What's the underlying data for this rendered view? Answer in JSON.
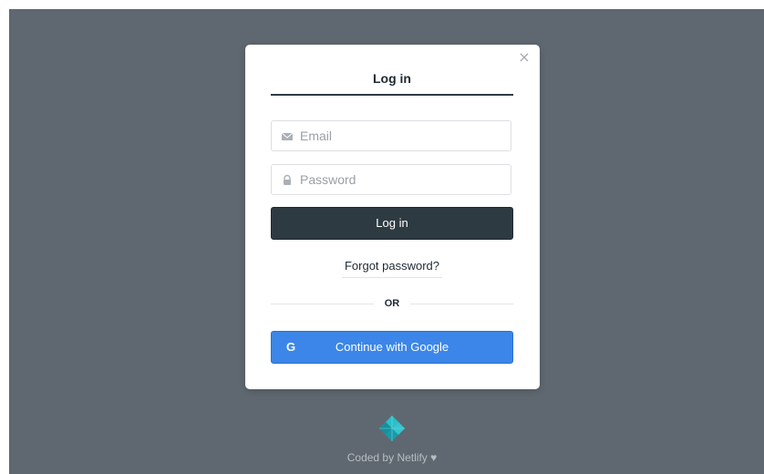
{
  "modal": {
    "close_glyph": "×",
    "tab_label": "Log in",
    "email": {
      "placeholder": "Email",
      "value": "",
      "icon": "envelope-icon"
    },
    "password": {
      "placeholder": "Password",
      "value": "",
      "icon": "lock-icon"
    },
    "login_button_label": "Log in",
    "forgot_password_label": "Forgot password?",
    "divider_label": "OR",
    "google_button": {
      "icon_glyph": "G",
      "label": "Continue with Google"
    }
  },
  "footer": {
    "logo_icon": "netlify-logo-icon",
    "text": "Coded by Netlify ♥"
  },
  "colors": {
    "backdrop": "#5f6870",
    "login_button": "#2e3a42",
    "google_button": "#3b86e8",
    "logo": "#1fa9b8"
  }
}
